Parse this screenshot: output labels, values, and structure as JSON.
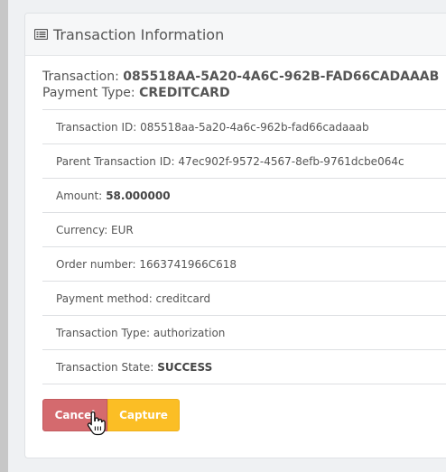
{
  "panel": {
    "title": "Transaction Information",
    "icon": "list-alt-icon"
  },
  "summary": {
    "transaction_label": "Transaction:",
    "transaction_value": "085518AA-5A20-4A6C-962B-FAD66CADAAAB",
    "payment_type_label": "Payment Type:",
    "payment_type_value": "CREDITCARD"
  },
  "details": [
    {
      "label": "Transaction ID: 085518aa-5a20-4a6c-962b-fad66cadaaab",
      "value": ""
    },
    {
      "label": "Parent Transaction ID: 47ec902f-9572-4567-8efb-9761dcbe064c",
      "value": ""
    },
    {
      "label": "Amount:",
      "value": "58.000000"
    },
    {
      "label": "Currency: EUR",
      "value": ""
    },
    {
      "label": "Order number: 1663741966C618",
      "value": ""
    },
    {
      "label": "Payment method: creditcard",
      "value": ""
    },
    {
      "label": "Transaction Type: authorization",
      "value": ""
    },
    {
      "label": "Transaction State:",
      "value": "SUCCESS"
    }
  ],
  "buttons": {
    "cancel": "Cancel",
    "capture": "Capture"
  },
  "colors": {
    "cancel": "#d46a6e",
    "capture": "#fbbe25"
  }
}
